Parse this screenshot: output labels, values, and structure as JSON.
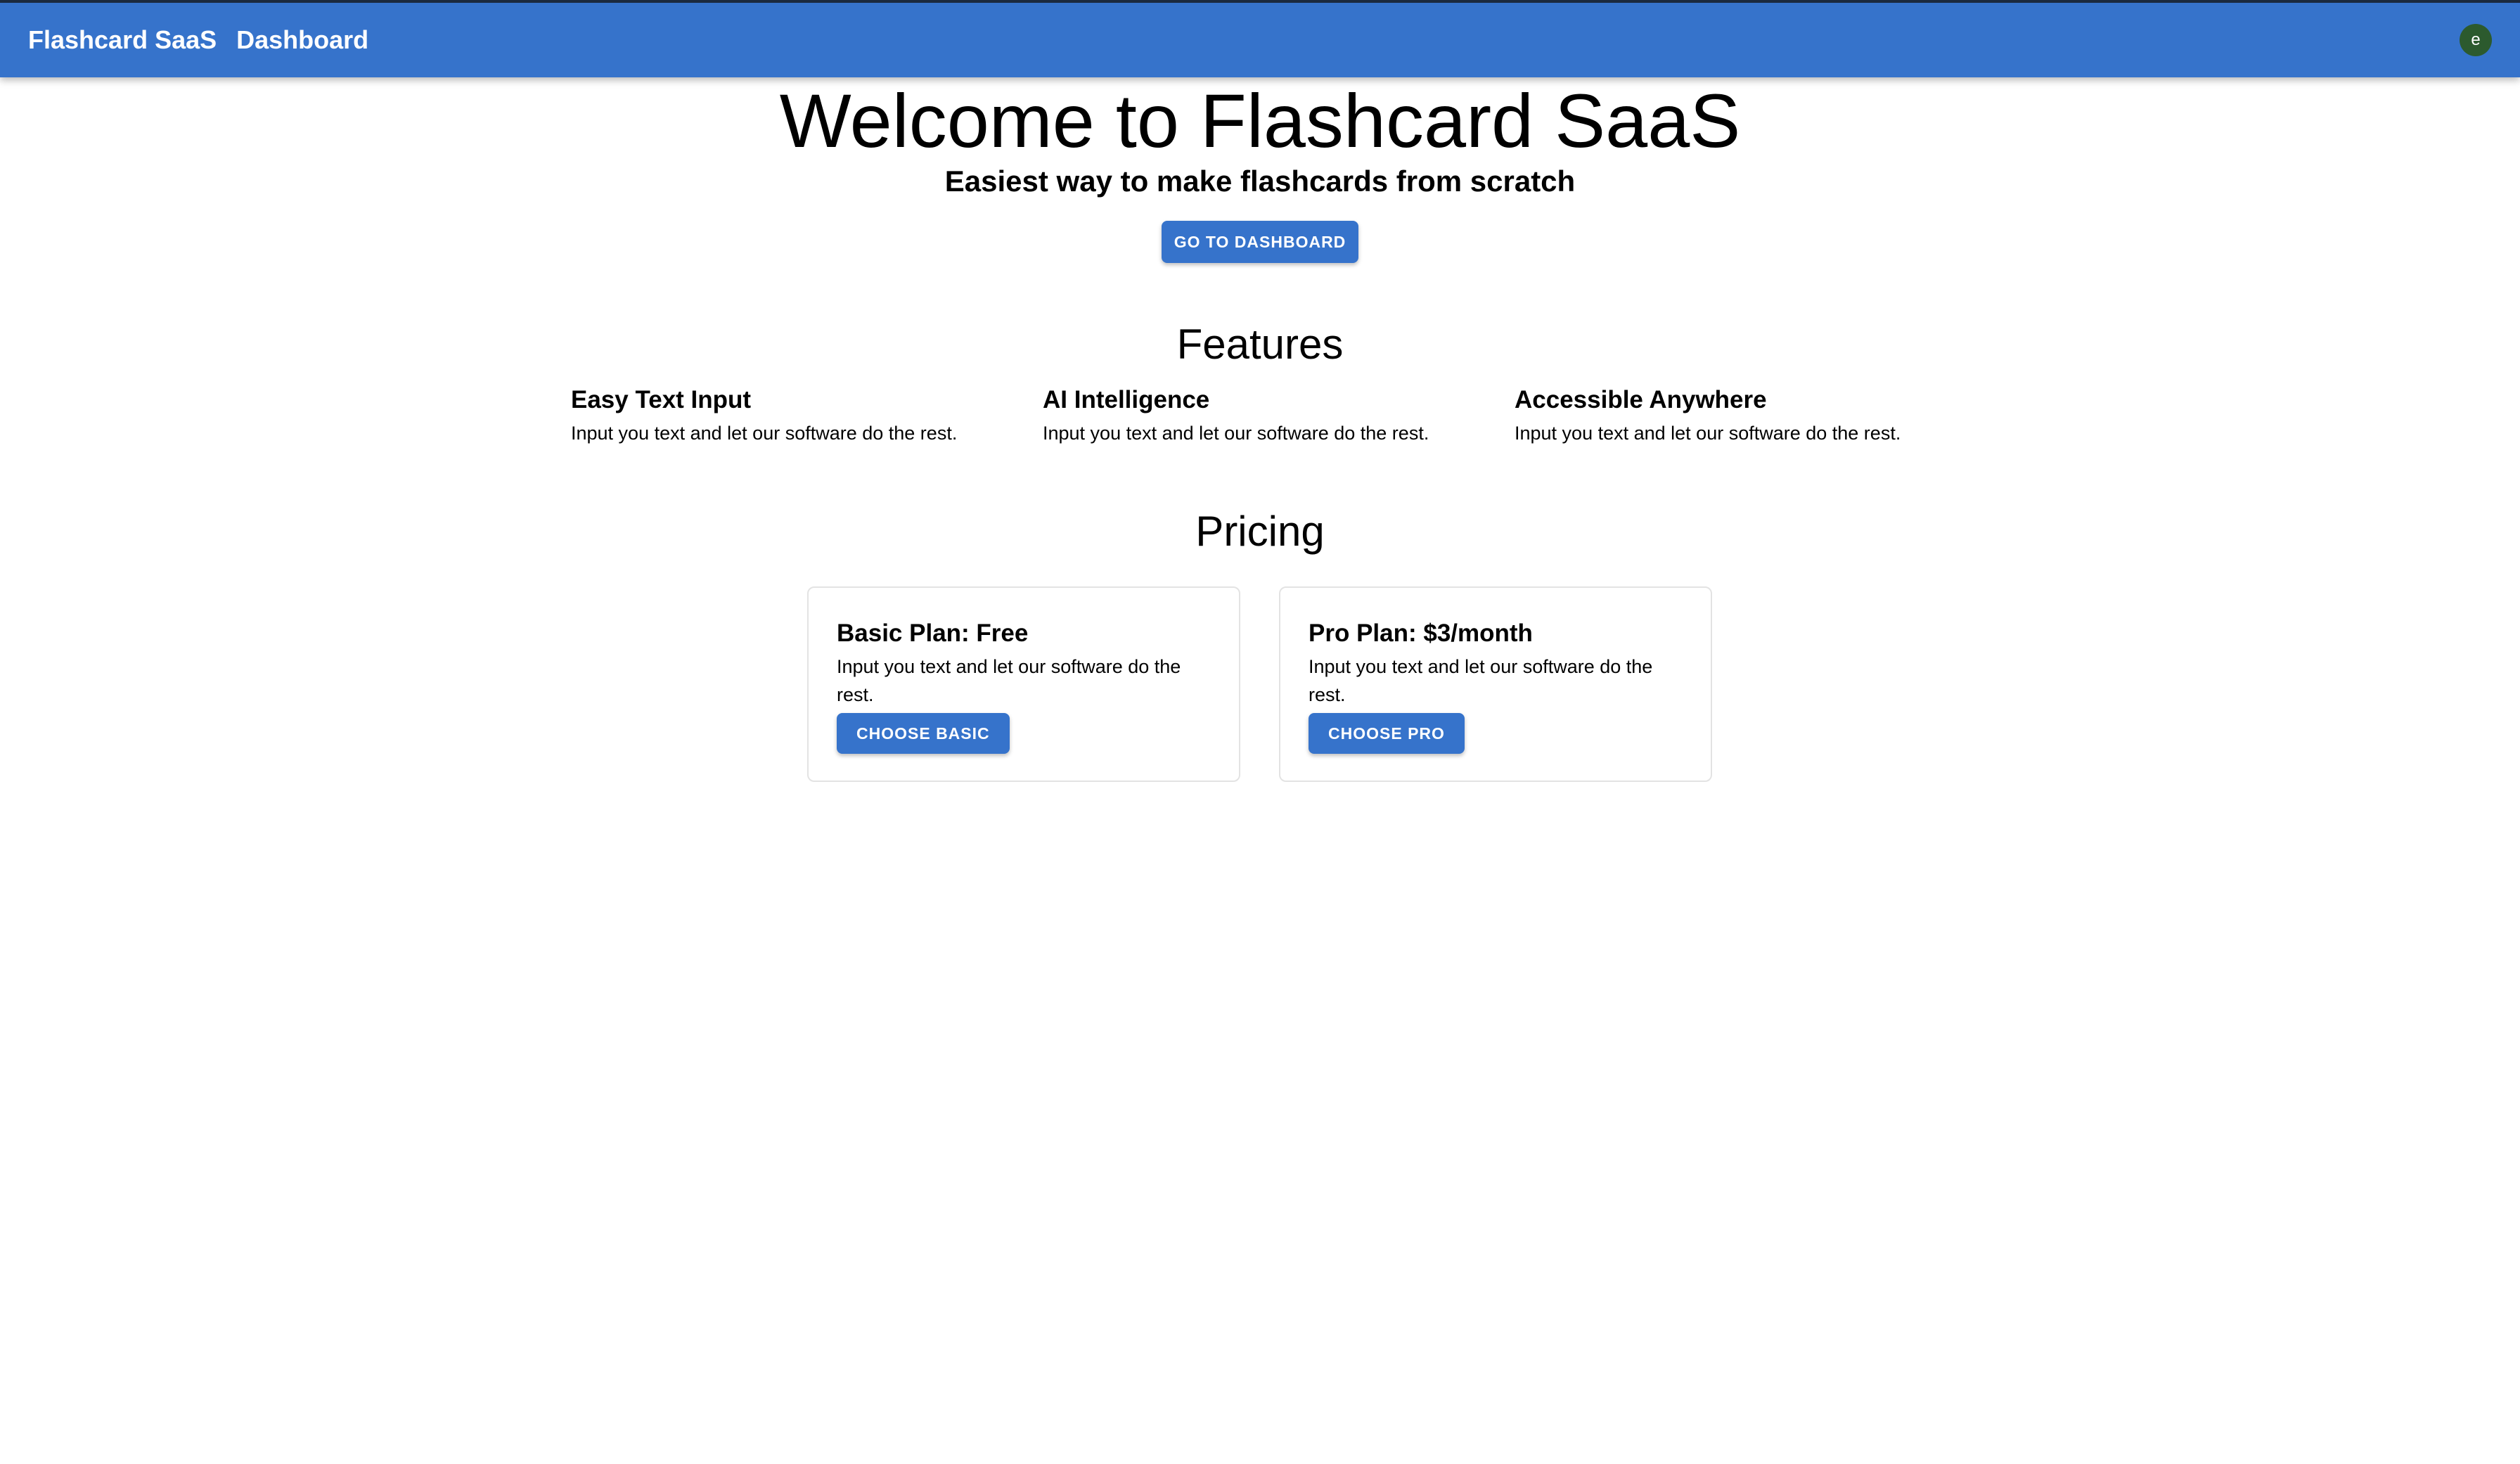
{
  "header": {
    "brand": "Flashcard SaaS",
    "nav_link": "Dashboard",
    "avatar_letter": "e"
  },
  "hero": {
    "title": "Welcome to Flashcard SaaS",
    "subtitle": "Easiest way to make flashcards from scratch",
    "button_label": "Go to Dashboard"
  },
  "features": {
    "title": "Features",
    "items": [
      {
        "title": "Easy Text Input",
        "description": "Input you text and let our software do the rest."
      },
      {
        "title": "AI Intelligence",
        "description": "Input you text and let our software do the rest."
      },
      {
        "title": "Accessible Anywhere",
        "description": "Input you text and let our software do the rest."
      }
    ]
  },
  "pricing": {
    "title": "Pricing",
    "plans": [
      {
        "title": "Basic Plan: Free",
        "description": "Input you text and let our software do the rest.",
        "button_label": "Choose Basic"
      },
      {
        "title": "Pro Plan: $3/month",
        "description": "Input you text and let our software do the rest.",
        "button_label": "Choose Pro"
      }
    ]
  },
  "colors": {
    "primary": "#3673cb",
    "avatar_bg": "#2c5a2e",
    "card_border": "#e3e3e3"
  }
}
